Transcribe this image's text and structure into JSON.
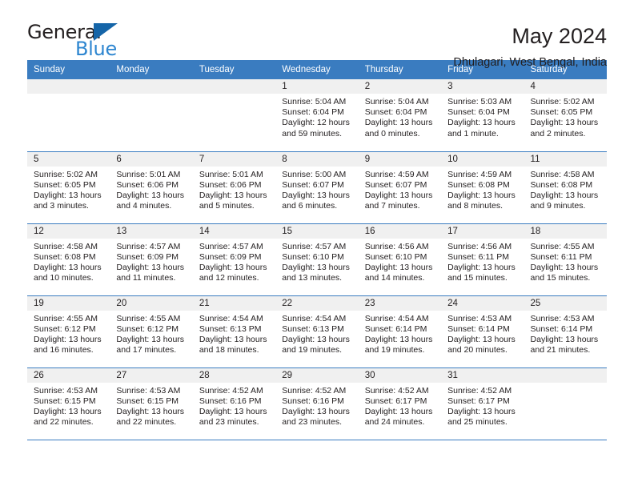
{
  "brand": {
    "name_part1": "General",
    "name_part2": "Blue",
    "triangle_icon": "triangle-icon",
    "accent_color": "#2e86d0",
    "header_color": "#3a7cc0"
  },
  "header": {
    "title": "May 2024",
    "subtitle": "Dhulagari, West Bengal, India"
  },
  "weekday_headers": [
    "Sunday",
    "Monday",
    "Tuesday",
    "Wednesday",
    "Thursday",
    "Friday",
    "Saturday"
  ],
  "weeks": [
    [
      {
        "day": "",
        "sunrise": "",
        "sunset": "",
        "daylight": "",
        "empty": true
      },
      {
        "day": "",
        "sunrise": "",
        "sunset": "",
        "daylight": "",
        "empty": true
      },
      {
        "day": "",
        "sunrise": "",
        "sunset": "",
        "daylight": "",
        "empty": true
      },
      {
        "day": "1",
        "sunrise": "Sunrise: 5:04 AM",
        "sunset": "Sunset: 6:04 PM",
        "daylight": "Daylight: 12 hours and 59 minutes."
      },
      {
        "day": "2",
        "sunrise": "Sunrise: 5:04 AM",
        "sunset": "Sunset: 6:04 PM",
        "daylight": "Daylight: 13 hours and 0 minutes."
      },
      {
        "day": "3",
        "sunrise": "Sunrise: 5:03 AM",
        "sunset": "Sunset: 6:04 PM",
        "daylight": "Daylight: 13 hours and 1 minute."
      },
      {
        "day": "4",
        "sunrise": "Sunrise: 5:02 AM",
        "sunset": "Sunset: 6:05 PM",
        "daylight": "Daylight: 13 hours and 2 minutes."
      }
    ],
    [
      {
        "day": "5",
        "sunrise": "Sunrise: 5:02 AM",
        "sunset": "Sunset: 6:05 PM",
        "daylight": "Daylight: 13 hours and 3 minutes."
      },
      {
        "day": "6",
        "sunrise": "Sunrise: 5:01 AM",
        "sunset": "Sunset: 6:06 PM",
        "daylight": "Daylight: 13 hours and 4 minutes."
      },
      {
        "day": "7",
        "sunrise": "Sunrise: 5:01 AM",
        "sunset": "Sunset: 6:06 PM",
        "daylight": "Daylight: 13 hours and 5 minutes."
      },
      {
        "day": "8",
        "sunrise": "Sunrise: 5:00 AM",
        "sunset": "Sunset: 6:07 PM",
        "daylight": "Daylight: 13 hours and 6 minutes."
      },
      {
        "day": "9",
        "sunrise": "Sunrise: 4:59 AM",
        "sunset": "Sunset: 6:07 PM",
        "daylight": "Daylight: 13 hours and 7 minutes."
      },
      {
        "day": "10",
        "sunrise": "Sunrise: 4:59 AM",
        "sunset": "Sunset: 6:08 PM",
        "daylight": "Daylight: 13 hours and 8 minutes."
      },
      {
        "day": "11",
        "sunrise": "Sunrise: 4:58 AM",
        "sunset": "Sunset: 6:08 PM",
        "daylight": "Daylight: 13 hours and 9 minutes."
      }
    ],
    [
      {
        "day": "12",
        "sunrise": "Sunrise: 4:58 AM",
        "sunset": "Sunset: 6:08 PM",
        "daylight": "Daylight: 13 hours and 10 minutes."
      },
      {
        "day": "13",
        "sunrise": "Sunrise: 4:57 AM",
        "sunset": "Sunset: 6:09 PM",
        "daylight": "Daylight: 13 hours and 11 minutes."
      },
      {
        "day": "14",
        "sunrise": "Sunrise: 4:57 AM",
        "sunset": "Sunset: 6:09 PM",
        "daylight": "Daylight: 13 hours and 12 minutes."
      },
      {
        "day": "15",
        "sunrise": "Sunrise: 4:57 AM",
        "sunset": "Sunset: 6:10 PM",
        "daylight": "Daylight: 13 hours and 13 minutes."
      },
      {
        "day": "16",
        "sunrise": "Sunrise: 4:56 AM",
        "sunset": "Sunset: 6:10 PM",
        "daylight": "Daylight: 13 hours and 14 minutes."
      },
      {
        "day": "17",
        "sunrise": "Sunrise: 4:56 AM",
        "sunset": "Sunset: 6:11 PM",
        "daylight": "Daylight: 13 hours and 15 minutes."
      },
      {
        "day": "18",
        "sunrise": "Sunrise: 4:55 AM",
        "sunset": "Sunset: 6:11 PM",
        "daylight": "Daylight: 13 hours and 15 minutes."
      }
    ],
    [
      {
        "day": "19",
        "sunrise": "Sunrise: 4:55 AM",
        "sunset": "Sunset: 6:12 PM",
        "daylight": "Daylight: 13 hours and 16 minutes."
      },
      {
        "day": "20",
        "sunrise": "Sunrise: 4:55 AM",
        "sunset": "Sunset: 6:12 PM",
        "daylight": "Daylight: 13 hours and 17 minutes."
      },
      {
        "day": "21",
        "sunrise": "Sunrise: 4:54 AM",
        "sunset": "Sunset: 6:13 PM",
        "daylight": "Daylight: 13 hours and 18 minutes."
      },
      {
        "day": "22",
        "sunrise": "Sunrise: 4:54 AM",
        "sunset": "Sunset: 6:13 PM",
        "daylight": "Daylight: 13 hours and 19 minutes."
      },
      {
        "day": "23",
        "sunrise": "Sunrise: 4:54 AM",
        "sunset": "Sunset: 6:14 PM",
        "daylight": "Daylight: 13 hours and 19 minutes."
      },
      {
        "day": "24",
        "sunrise": "Sunrise: 4:53 AM",
        "sunset": "Sunset: 6:14 PM",
        "daylight": "Daylight: 13 hours and 20 minutes."
      },
      {
        "day": "25",
        "sunrise": "Sunrise: 4:53 AM",
        "sunset": "Sunset: 6:14 PM",
        "daylight": "Daylight: 13 hours and 21 minutes."
      }
    ],
    [
      {
        "day": "26",
        "sunrise": "Sunrise: 4:53 AM",
        "sunset": "Sunset: 6:15 PM",
        "daylight": "Daylight: 13 hours and 22 minutes."
      },
      {
        "day": "27",
        "sunrise": "Sunrise: 4:53 AM",
        "sunset": "Sunset: 6:15 PM",
        "daylight": "Daylight: 13 hours and 22 minutes."
      },
      {
        "day": "28",
        "sunrise": "Sunrise: 4:52 AM",
        "sunset": "Sunset: 6:16 PM",
        "daylight": "Daylight: 13 hours and 23 minutes."
      },
      {
        "day": "29",
        "sunrise": "Sunrise: 4:52 AM",
        "sunset": "Sunset: 6:16 PM",
        "daylight": "Daylight: 13 hours and 23 minutes."
      },
      {
        "day": "30",
        "sunrise": "Sunrise: 4:52 AM",
        "sunset": "Sunset: 6:17 PM",
        "daylight": "Daylight: 13 hours and 24 minutes."
      },
      {
        "day": "31",
        "sunrise": "Sunrise: 4:52 AM",
        "sunset": "Sunset: 6:17 PM",
        "daylight": "Daylight: 13 hours and 25 minutes."
      },
      {
        "day": "",
        "sunrise": "",
        "sunset": "",
        "daylight": "",
        "empty": true
      }
    ]
  ]
}
